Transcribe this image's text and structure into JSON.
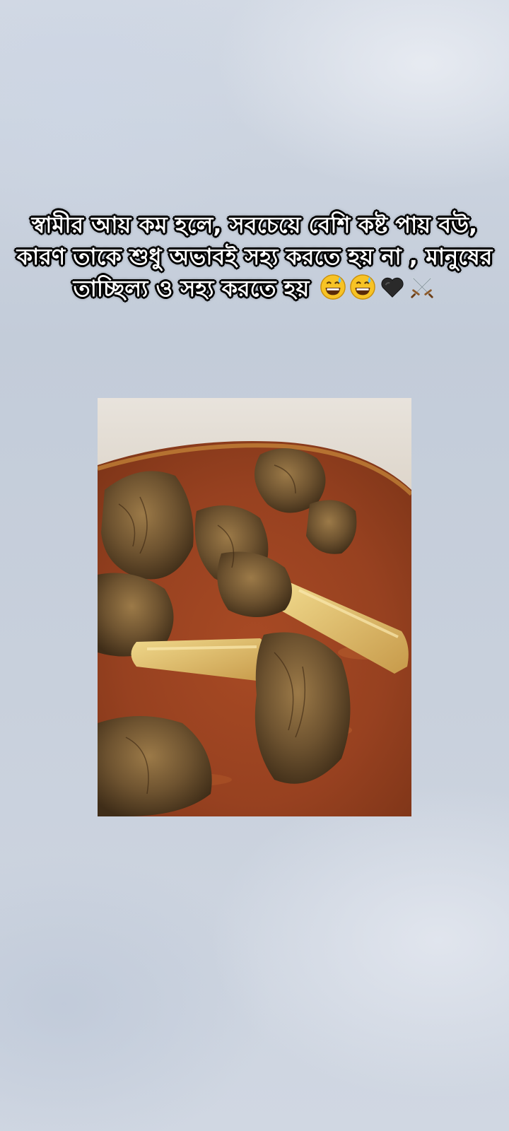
{
  "post": {
    "caption": "স্বামীর আয় কম হলে, সবচেয়ে বেশি কষ্ট পায় বউ, কারণ তাকে শুধু অভাবই সহ্য করতে হয় না , মানুষের তাচ্ছিল্য ও সহ্য করতে হয়",
    "emojis": [
      "grinning-sweat-icon",
      "grinning-sweat-icon",
      "black-heart-icon",
      "crossed-swords-icon"
    ],
    "image": "mutton-curry-in-pot-photo"
  },
  "colors": {
    "background": "#c8d0dc",
    "caption_text": "#ffffff",
    "caption_outline": "#000000",
    "curry_gravy": "#9a4522",
    "meat": "#6e5330"
  }
}
